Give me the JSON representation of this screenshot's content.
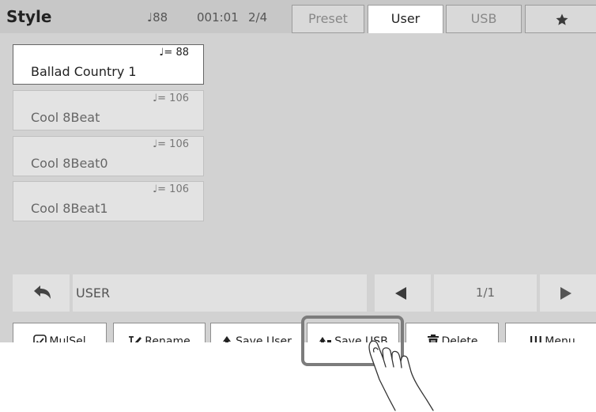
{
  "header": {
    "title": "Style",
    "tempo": "♩88",
    "measure": "001:01",
    "time_signature": "2/4",
    "tabs": [
      {
        "label": "Preset",
        "active": false
      },
      {
        "label": "User",
        "active": true
      },
      {
        "label": "USB",
        "active": false
      },
      {
        "icon": "star-icon",
        "active": false
      }
    ]
  },
  "style_list": [
    {
      "tempo": "♩= 88",
      "name": "Ballad Country 1",
      "selected": true
    },
    {
      "tempo": "♩= 106",
      "name": "Cool 8Beat",
      "selected": false
    },
    {
      "tempo": "♩= 106",
      "name": "Cool 8Beat0",
      "selected": false
    },
    {
      "tempo": "♩= 106",
      "name": "Cool 8Beat1",
      "selected": false
    }
  ],
  "navigation": {
    "back_icon": "undo-arrow-icon",
    "folder": "USER",
    "prev_icon": "triangle-left-icon",
    "page": "1/1",
    "next_icon": "triangle-right-icon"
  },
  "functions": {
    "mulsel": "MulSel",
    "rename": "Rename",
    "save_user": "Save User",
    "save_usb": "Save USB",
    "delete": "Delete",
    "menu": "Menu"
  },
  "colors": {
    "screen_bg": "#d2d2d2",
    "header_bg": "#c7c7c7",
    "highlight_border": "#7c7c7c"
  }
}
